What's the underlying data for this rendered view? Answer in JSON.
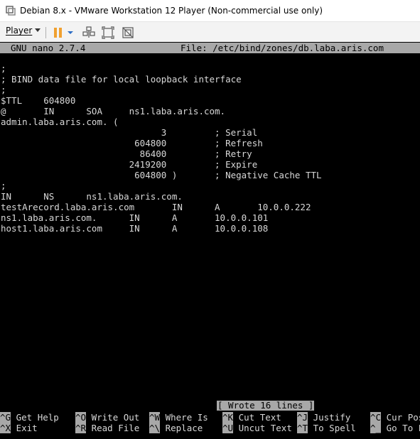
{
  "window": {
    "title": "Debian 8.x - VMware Workstation 12 Player (Non-commercial use only)"
  },
  "toolbar": {
    "player_label": "Player",
    "icons": [
      "pause-icon",
      "dropdown-arrow-icon",
      "send-ctrl-alt-del-icon",
      "fit-window-icon",
      "unity-icon"
    ]
  },
  "nano": {
    "version": "GNU nano 2.7.4",
    "file": "File: /etc/bind/zones/db.laba.aris.com"
  },
  "lines": [
    ";",
    "; BIND data file for local loopback interface",
    ";",
    "$TTL    604800",
    "@       IN      SOA     ns1.laba.aris.com.",
    "admin.laba.aris.com. (",
    "                              3         ; Serial",
    "                         604800         ; Refresh",
    "                          86400         ; Retry",
    "                        2419200         ; Expire",
    "                         604800 )       ; Negative Cache TTL",
    ";",
    "IN      NS      ns1.laba.aris.com.",
    "testArecord.laba.aris.com       IN      A       10.0.0.222",
    "ns1.laba.aris.com.      IN      A       10.0.0.101",
    "host1.laba.aris.com     IN      A       10.0.0.108"
  ],
  "status": "[ Wrote 16 lines ]",
  "shortcuts_row1": [
    {
      "key": "^G",
      "label": "Get Help"
    },
    {
      "key": "^O",
      "label": "Write Out"
    },
    {
      "key": "^W",
      "label": "Where Is"
    },
    {
      "key": "^K",
      "label": "Cut Text"
    },
    {
      "key": "^J",
      "label": "Justify"
    },
    {
      "key": "^C",
      "label": "Cur Pos"
    }
  ],
  "shortcuts_row2": [
    {
      "key": "^X",
      "label": "Exit"
    },
    {
      "key": "^R",
      "label": "Read File"
    },
    {
      "key": "^\\",
      "label": "Replace"
    },
    {
      "key": "^U",
      "label": "Uncut Text"
    },
    {
      "key": "^T",
      "label": "To Spell"
    },
    {
      "key": "^_",
      "label": "Go To L"
    }
  ],
  "colors": {
    "terminal_bg": "#000000",
    "terminal_fg": "#d8d8d8",
    "highlight_bg": "#a8a8a8",
    "pause_orange": "#f0a030",
    "accent_blue": "#2b6cc4"
  }
}
